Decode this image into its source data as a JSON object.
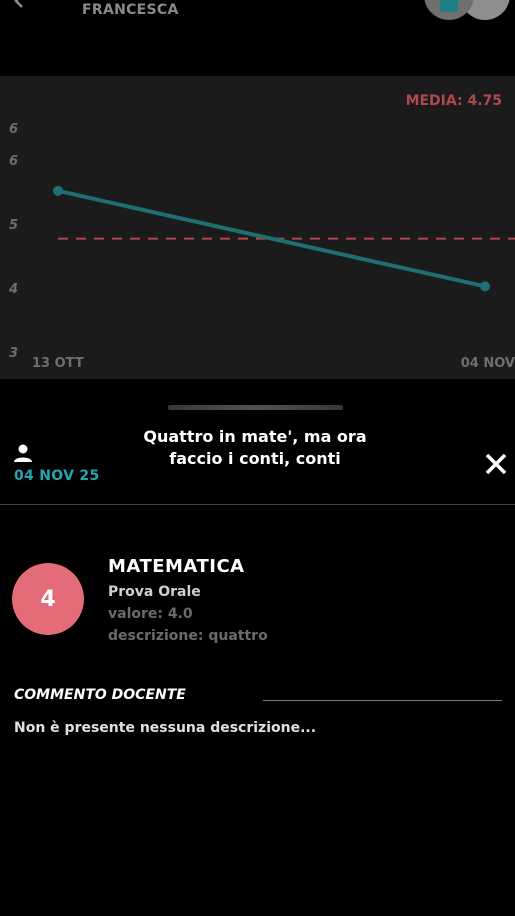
{
  "header": {
    "user_name": "FRANCESCA"
  },
  "chart_data": {
    "type": "line",
    "average_label": "MEDIA: 4.75",
    "average": 4.75,
    "y_ticks": [
      "6",
      "6",
      "5",
      "4",
      "3"
    ],
    "x_ticks": [
      "13 OTT",
      "04 NOV"
    ],
    "ylim": [
      3,
      6.5
    ],
    "series": [
      {
        "x": [
          "13 OTT",
          "04 NOV"
        ],
        "values": [
          5.5,
          4.0
        ],
        "color": "#1e6e72"
      }
    ],
    "average_color": "#b0484f",
    "grid": false
  },
  "grade": {
    "date": "04 NOV 25",
    "title": "Quattro in mate', ma ora faccio i conti, conti",
    "value_display": "4",
    "subject": "MATEMATICA",
    "type": "Prova Orale",
    "valore": "valore: 4.0",
    "descrizione": "descrizione: quattro",
    "circle_color": "#e46b78"
  },
  "comment": {
    "title": "COMMENTO DOCENTE",
    "body": "Non è presente nessuna descrizione..."
  }
}
